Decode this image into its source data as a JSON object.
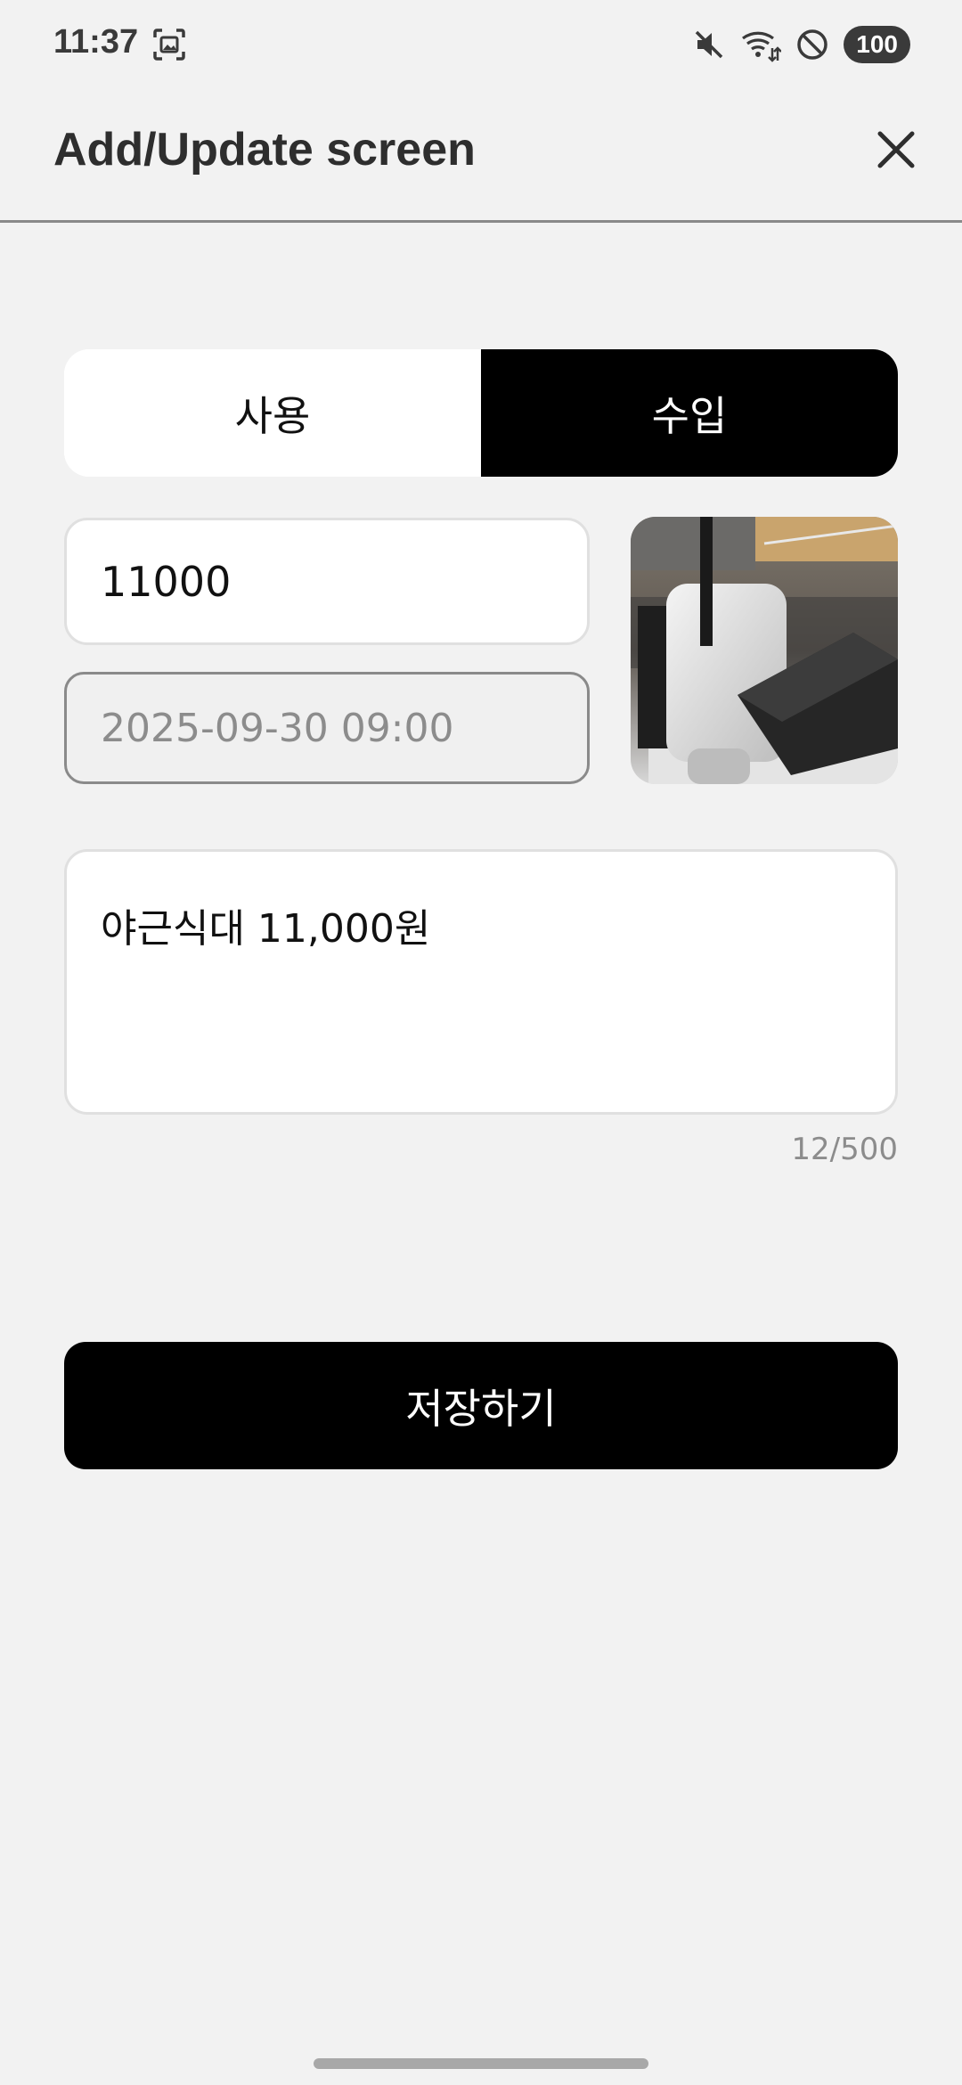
{
  "status_bar": {
    "time": "11:37",
    "battery": "100",
    "icons": [
      "screenshot-icon",
      "mute-icon",
      "wifi-icon",
      "do-not-disturb-icon"
    ]
  },
  "app_bar": {
    "title": "Add/Update screen",
    "close_icon": "close-icon"
  },
  "toggle": {
    "options": [
      "사용",
      "수입"
    ],
    "selected": "수입"
  },
  "form": {
    "amount_value": "11000",
    "date_value": "2025-09-30 09:00",
    "memo_value": "야근식대 11,000원",
    "memo_counter": "12/500"
  },
  "save_label": "저장하기",
  "colors": {
    "background": "#f2f2f2",
    "primary": "#000000",
    "on_primary": "#ffffff",
    "muted_text": "#8c8c8c"
  }
}
